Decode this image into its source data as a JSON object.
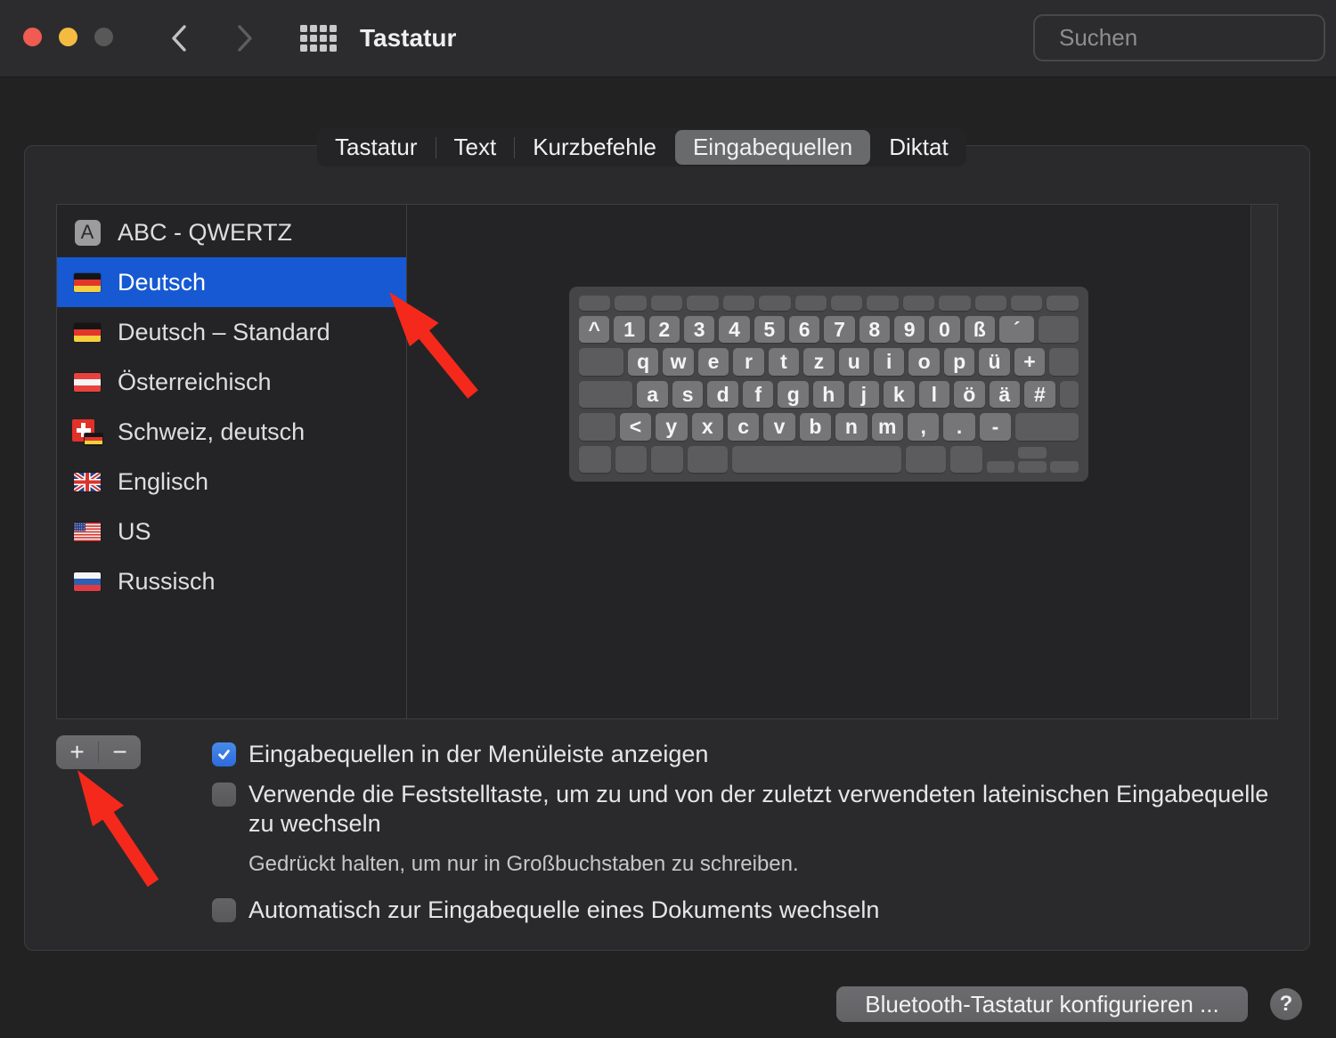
{
  "window": {
    "title": "Tastatur",
    "search_placeholder": "Suchen"
  },
  "tabs": {
    "items": [
      {
        "label": "Tastatur",
        "selected": false
      },
      {
        "label": "Text",
        "selected": false
      },
      {
        "label": "Kurzbefehle",
        "selected": false
      },
      {
        "label": "Eingabequellen",
        "selected": true
      },
      {
        "label": "Diktat",
        "selected": false
      }
    ]
  },
  "input_sources": {
    "items": [
      {
        "label": "ABC - QWERTZ",
        "icon": "abc",
        "selected": false
      },
      {
        "label": "Deutsch",
        "icon": "de",
        "selected": true
      },
      {
        "label": "Deutsch – Standard",
        "icon": "de",
        "selected": false
      },
      {
        "label": "Österreichisch",
        "icon": "at",
        "selected": false
      },
      {
        "label": "Schweiz, deutsch",
        "icon": "ch-de",
        "selected": false
      },
      {
        "label": "Englisch",
        "icon": "gb",
        "selected": false
      },
      {
        "label": "US",
        "icon": "us",
        "selected": false
      },
      {
        "label": "Russisch",
        "icon": "ru",
        "selected": false
      }
    ]
  },
  "keyboard_preview": {
    "rows": [
      {
        "type": "function",
        "keys": [
          [
            "",
            1
          ],
          [
            "",
            1
          ],
          [
            "",
            1
          ],
          [
            "",
            1
          ],
          [
            "",
            1
          ],
          [
            "",
            1
          ],
          [
            "",
            1
          ],
          [
            "",
            1
          ],
          [
            "",
            1
          ],
          [
            "",
            1
          ],
          [
            "",
            1
          ],
          [
            "",
            1
          ],
          [
            "",
            1
          ],
          [
            "",
            1
          ]
        ]
      },
      {
        "type": "normal",
        "keys": [
          [
            "^",
            1
          ],
          [
            "1",
            1
          ],
          [
            "2",
            1
          ],
          [
            "3",
            1
          ],
          [
            "4",
            1
          ],
          [
            "5",
            1
          ],
          [
            "6",
            1
          ],
          [
            "7",
            1
          ],
          [
            "8",
            1
          ],
          [
            "9",
            1
          ],
          [
            "0",
            1
          ],
          [
            "ß",
            1
          ],
          [
            "´",
            1.15
          ],
          [
            "",
            1.3
          ]
        ]
      },
      {
        "type": "normal",
        "keys": [
          [
            "",
            1.45
          ],
          [
            "q",
            1
          ],
          [
            "w",
            1
          ],
          [
            "e",
            1
          ],
          [
            "r",
            1
          ],
          [
            "t",
            1
          ],
          [
            "z",
            1
          ],
          [
            "u",
            1
          ],
          [
            "i",
            1
          ],
          [
            "o",
            1
          ],
          [
            "p",
            1
          ],
          [
            "ü",
            1
          ],
          [
            "+",
            1
          ],
          [
            "",
            0.95
          ]
        ]
      },
      {
        "type": "normal",
        "keys": [
          [
            "",
            1.75
          ],
          [
            "a",
            1
          ],
          [
            "s",
            1
          ],
          [
            "d",
            1
          ],
          [
            "f",
            1
          ],
          [
            "g",
            1
          ],
          [
            "h",
            1
          ],
          [
            "j",
            1
          ],
          [
            "k",
            1
          ],
          [
            "l",
            1
          ],
          [
            "ö",
            1
          ],
          [
            "ä",
            1
          ],
          [
            "#",
            1
          ],
          [
            "",
            0.62
          ]
        ]
      },
      {
        "type": "normal",
        "keys": [
          [
            "",
            1.15
          ],
          [
            "<",
            1
          ],
          [
            "y",
            1
          ],
          [
            "x",
            1
          ],
          [
            "c",
            1
          ],
          [
            "v",
            1
          ],
          [
            "b",
            1
          ],
          [
            "n",
            1
          ],
          [
            "m",
            1
          ],
          [
            ",",
            1
          ],
          [
            ".",
            1
          ],
          [
            "-",
            1
          ],
          [
            "",
            2.0
          ]
        ]
      },
      {
        "type": "bottom",
        "keys": [
          [
            "",
            1
          ],
          [
            "",
            1
          ],
          [
            "",
            1
          ],
          [
            "",
            1.25
          ],
          [
            "",
            5.35
          ],
          [
            "",
            1.25
          ],
          [
            "",
            1
          ]
        ]
      }
    ]
  },
  "options": {
    "add_button": "+",
    "remove_button": "−",
    "checkboxes": [
      {
        "label": "Eingabequellen in der Menüleiste anzeigen",
        "checked": true,
        "note": ""
      },
      {
        "label": "Verwende die Feststelltaste, um zu und von der zuletzt verwendeten lateinischen Eingabequelle zu wechseln",
        "checked": false,
        "note": "Gedrückt halten, um nur in Großbuchstaben zu schreiben."
      },
      {
        "label": "Automatisch zur Eingabequelle eines Dokuments wechseln",
        "checked": false,
        "note": ""
      }
    ]
  },
  "footer": {
    "configure_button": "Bluetooth-Tastatur konfigurieren ...",
    "help_button": "?"
  },
  "colors": {
    "selection_blue": "#1659d2",
    "checkbox_blue": "#3478e2",
    "annotation_red": "#f5281c",
    "window_bg": "#222223",
    "titlebar_bg": "#2c2c2e",
    "key_gray": "#767679"
  }
}
